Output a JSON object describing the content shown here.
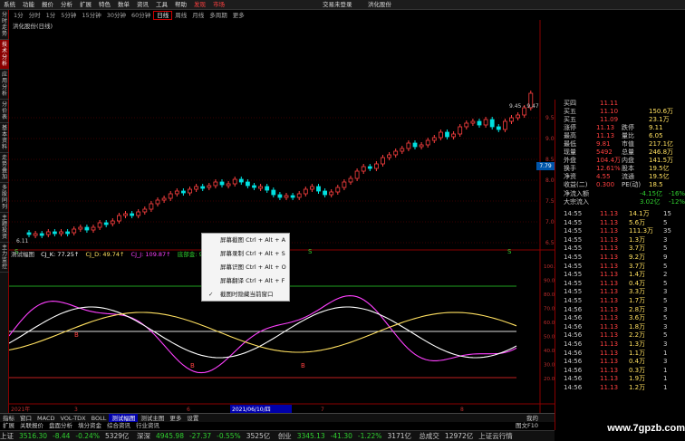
{
  "menu": {
    "items": [
      "系统",
      "功能",
      "报价",
      "分析",
      "扩展",
      "特色",
      "数单",
      "资讯",
      "工具",
      "帮助"
    ],
    "hot_items": [
      "发现",
      "市场"
    ],
    "right_items": [
      "交易未登录",
      "洪化股份"
    ]
  },
  "periods": [
    "1分",
    "分时",
    "1分",
    "5分钟",
    "15分钟",
    "30分钟",
    "60分钟",
    "日线",
    "周线",
    "月线",
    "多周期",
    "更多"
  ],
  "active_period": "日线",
  "chart_title": "洪化股份(日线)",
  "left_tabs": [
    "分时走势",
    "技术分析",
    "应用分析",
    "分价表",
    "基本资料",
    "走势叠加",
    "多股同列",
    "主题投资",
    "主力监控"
  ],
  "price_axis": [
    "9.50",
    "9.00",
    "8.50",
    "8.00",
    "7.50",
    "7.00",
    "6.50"
  ],
  "high_label": "9.45 - 9.47",
  "low_label": "6.11",
  "current_price_tag": "7.79",
  "osc_axis": [
    "100.00",
    "90.00",
    "80.00",
    "70.00",
    "60.00",
    "50.00",
    "40.00",
    "30.00",
    "20.00"
  ],
  "osc_legend": {
    "name": "测试幅图",
    "k": "CJ_K: 77.25↑",
    "d": "CJ_D: 49.74↑",
    "j": "CJ_J: 109.87↑",
    "extra": "底部金: 90.00"
  },
  "date_axis": {
    "left": "2021年",
    "cursor": "2021/06/10/四",
    "marks": [
      "3",
      "5",
      "6",
      "7",
      "8"
    ]
  },
  "context_menu": [
    {
      "label": "屏幕截图 Ctrl + Alt + A",
      "checked": false
    },
    {
      "label": "屏幕录制 Ctrl + Alt + S",
      "checked": false
    },
    {
      "label": "屏幕识图 Ctrl + Alt + O",
      "checked": false
    },
    {
      "label": "屏幕翻译 Ctrl + Alt + F",
      "checked": false
    },
    {
      "label": "截图时隐藏当前窗口",
      "checked": true
    }
  ],
  "quote_panel": {
    "order_book": [
      {
        "label": "买四",
        "price": "11.11",
        "vol": "",
        "color": "#ff4040"
      },
      {
        "label": "买五",
        "price": "11.10",
        "vol": "150.6万",
        "color": "#ff4040"
      },
      {
        "label": "买五",
        "price": "11.09",
        "vol": "23.1万",
        "color": "#ff4040"
      }
    ],
    "stats": [
      {
        "l1": "涨停",
        "v1": "11.13",
        "l2": "跌停",
        "v2": "9.11"
      },
      {
        "l1": "最高",
        "v1": "11.13",
        "l2": "量比",
        "v2": "6.05"
      },
      {
        "l1": "最低",
        "v1": "9.81",
        "l2": "市值",
        "v2": "217.1亿"
      },
      {
        "l1": "现量",
        "v1": "5492",
        "l2": "总量",
        "v2": "246.8万"
      },
      {
        "l1": "外盘",
        "v1": "104.4万",
        "l2": "内盘",
        "v2": "141.5万"
      },
      {
        "l1": "换手",
        "v1": "12.61%",
        "l2": "股本",
        "v2": "19.5亿"
      },
      {
        "l1": "净资",
        "v1": "4.55",
        "l2": "流通",
        "v2": "19.5亿"
      },
      {
        "l1": "收益(二)",
        "v1": "0.300",
        "l2": "PE(动)",
        "v2": "18.5"
      }
    ],
    "flows": [
      {
        "label": "净流入额",
        "value": "-4.15亿",
        "pct": "-16%"
      },
      {
        "label": "大宗流入",
        "value": "3.02亿",
        "pct": "-12%"
      }
    ],
    "ticks": [
      {
        "time": "14:55",
        "price": "11.13",
        "vol": "14.1万",
        "n": "15"
      },
      {
        "time": "14:55",
        "price": "11.13",
        "vol": "5.6万",
        "n": "5"
      },
      {
        "time": "14:55",
        "price": "11.13",
        "vol": "111.3万",
        "n": "35"
      },
      {
        "time": "14:55",
        "price": "11.13",
        "vol": "1.3万",
        "n": "3"
      },
      {
        "time": "14:55",
        "price": "11.13",
        "vol": "3.7万",
        "n": "5"
      },
      {
        "time": "14:55",
        "price": "11.13",
        "vol": "9.2万",
        "n": "9"
      },
      {
        "time": "14:55",
        "price": "11.13",
        "vol": "3.7万",
        "n": "5"
      },
      {
        "time": "14:55",
        "price": "11.13",
        "vol": "1.4万",
        "n": "2"
      },
      {
        "time": "14:55",
        "price": "11.13",
        "vol": "0.4万",
        "n": "5"
      },
      {
        "time": "14:55",
        "price": "11.13",
        "vol": "3.3万",
        "n": "3"
      },
      {
        "time": "14:55",
        "price": "11.13",
        "vol": "1.7万",
        "n": "5"
      },
      {
        "time": "14:56",
        "price": "11.13",
        "vol": "2.8万",
        "n": "3"
      },
      {
        "time": "14:56",
        "price": "11.13",
        "vol": "3.6万",
        "n": "5"
      },
      {
        "time": "14:56",
        "price": "11.13",
        "vol": "1.8万",
        "n": "3"
      },
      {
        "time": "14:56",
        "price": "11.13",
        "vol": "2.2万",
        "n": "5"
      },
      {
        "time": "14:56",
        "price": "11.13",
        "vol": "1.3万",
        "n": "3"
      },
      {
        "time": "14:56",
        "price": "11.13",
        "vol": "1.1万",
        "n": "1"
      },
      {
        "time": "14:56",
        "price": "11.13",
        "vol": "0.4万",
        "n": "3"
      },
      {
        "time": "14:56",
        "price": "11.13",
        "vol": "0.3万",
        "n": "1"
      },
      {
        "time": "14:56",
        "price": "11.13",
        "vol": "1.9万",
        "n": "1"
      },
      {
        "time": "14:56",
        "price": "11.13",
        "vol": "1.2万",
        "n": "1"
      }
    ]
  },
  "bottom_tabs": [
    "指标",
    "窗口",
    "MACD",
    "VOL-TDX",
    "BOLL",
    "测试幅图",
    "测试主图",
    "更多",
    "设置"
  ],
  "active_bottom_tab": "测试幅图",
  "bottom_tabs2": [
    "扩展",
    "关联报价",
    "盘面分析",
    "填分资金",
    "综合资讯",
    "行业资讯"
  ],
  "right_bottom": {
    "label1": "图文F10",
    "label2": "我的"
  },
  "status": [
    {
      "name": "上证",
      "value": "3516.30",
      "chg": "-8.44",
      "pct": "-0.24%",
      "amt": "5329亿"
    },
    {
      "name": "深深",
      "value": "4945.98",
      "chg": "-27.37",
      "pct": "-0.55%",
      "amt": "3525亿"
    },
    {
      "name": "创业",
      "value": "3345.13",
      "chg": "-41.30",
      "pct": "-1.22%",
      "amt": "3171亿"
    }
  ],
  "total_amt": "总成交",
  "total_value": "12972亿",
  "status_tail": "上证云行情",
  "watermark": "www.7gpzb.com",
  "colors": {
    "up": "#ff4040",
    "down": "#00e0e0",
    "border": "#8a0000"
  }
}
